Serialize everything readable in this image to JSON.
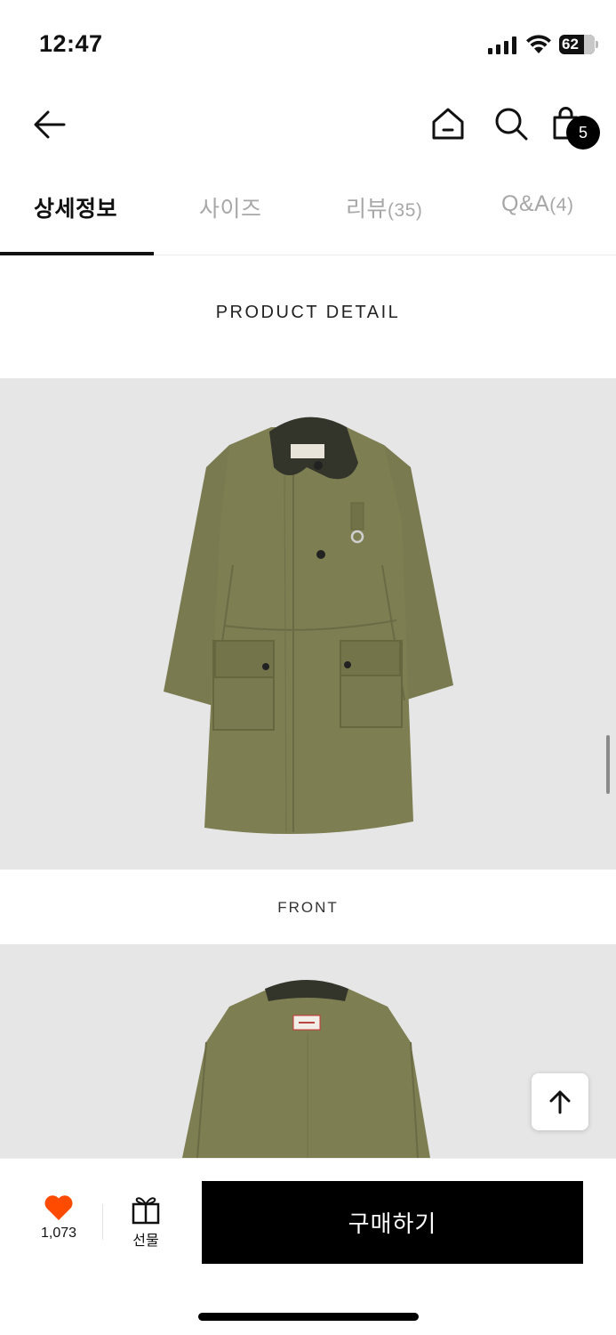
{
  "status_bar": {
    "time": "12:47",
    "battery": "62"
  },
  "nav": {
    "cart_count": "5"
  },
  "tabs": [
    {
      "label": "상세정보",
      "count": ""
    },
    {
      "label": "사이즈",
      "count": ""
    },
    {
      "label": "리뷰",
      "count": "(35)"
    },
    {
      "label": "Q&A",
      "count": "(4)"
    }
  ],
  "content": {
    "section_title": "PRODUCT DETAIL",
    "front_caption": "FRONT"
  },
  "colors": {
    "accent": "#ff4b00",
    "coat": "#7c7c52",
    "collar": "#33332a",
    "photo_bg": "#e6e6e6"
  },
  "bottom_bar": {
    "like_count": "1,073",
    "gift_label": "선물",
    "buy_label": "구매하기"
  }
}
